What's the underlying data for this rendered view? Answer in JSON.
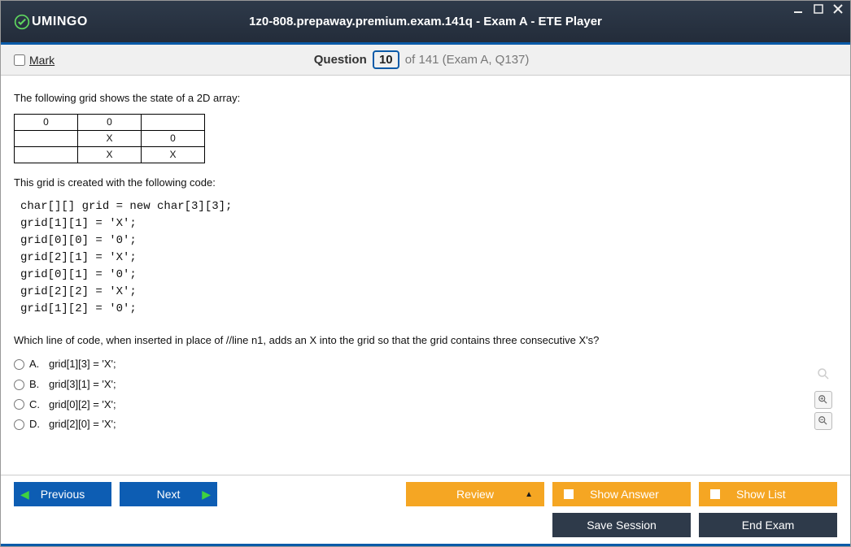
{
  "header": {
    "brand": "UMINGO",
    "title": "1z0-808.prepaway.premium.exam.141q - Exam A - ETE Player"
  },
  "qheader": {
    "mark_label": "Mark",
    "q_word": "Question",
    "current": "10",
    "total_text": "of 141 (Exam A, Q137)"
  },
  "body": {
    "intro1": "The following grid shows the state of a 2D array:",
    "grid": [
      [
        "0",
        "0",
        ""
      ],
      [
        "",
        "X",
        "0"
      ],
      [
        "",
        "X",
        "X"
      ]
    ],
    "intro2": "This grid is created with the following code:",
    "code": "char[][] grid = new char[3][3];\ngrid[1][1] = 'X';\ngrid[0][0] = '0';\ngrid[2][1] = 'X';\ngrid[0][1] = '0';\ngrid[2][2] = 'X';\ngrid[1][2] = '0';",
    "question": "Which line of code, when inserted in place of //line n1, adds an X into the grid so that the grid contains three consecutive X's?",
    "options": [
      {
        "letter": "A.",
        "text": "grid[1][3] = 'X';"
      },
      {
        "letter": "B.",
        "text": "grid[3][1] = 'X';"
      },
      {
        "letter": "C.",
        "text": "grid[0][2] = 'X';"
      },
      {
        "letter": "D.",
        "text": "grid[2][0] = 'X';"
      }
    ]
  },
  "footer": {
    "previous": "Previous",
    "next": "Next",
    "review": "Review",
    "show_answer": "Show Answer",
    "show_list": "Show List",
    "save_session": "Save Session",
    "end_exam": "End Exam"
  }
}
